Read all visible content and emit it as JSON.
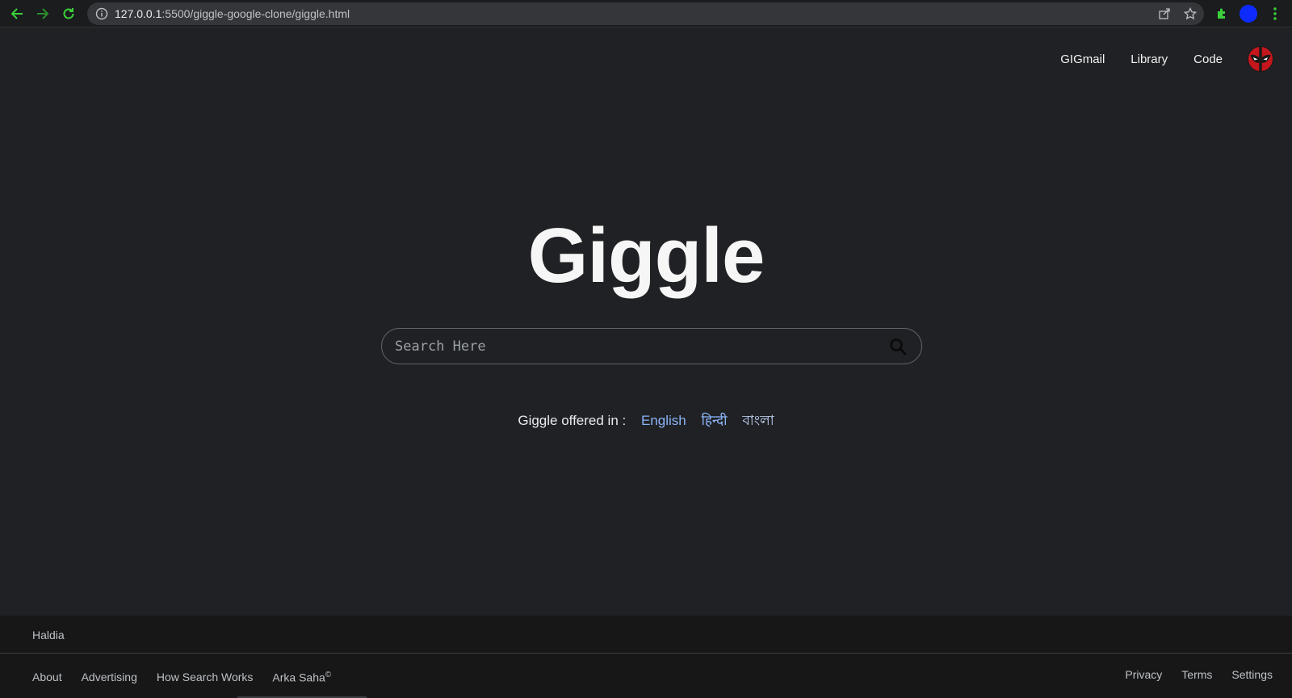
{
  "browser": {
    "url_host": "127.0.0.1",
    "url_rest": ":5500/giggle-google-clone/giggle.html",
    "icons": [
      "back-arrow-icon",
      "forward-arrow-icon",
      "reload-icon",
      "info-icon",
      "share-icon",
      "star-icon",
      "extensions-icon",
      "profile-icon",
      "menu-icon"
    ]
  },
  "topnav": {
    "gmail": "GIGmail",
    "library": "Library",
    "code": "Code",
    "avatar_icon": "deadpool-avatar-icon"
  },
  "logo": "Giggle",
  "search": {
    "placeholder": "Search Here",
    "icon": "search-icon"
  },
  "offered": {
    "label": "Giggle offered in :",
    "languages": [
      "English",
      "हिन्दी",
      "বাংলা"
    ]
  },
  "footer": {
    "location": "Haldia",
    "left_links": [
      "About",
      "Advertising",
      "How Search Works",
      "Arka Saha"
    ],
    "copyright_mark": "©",
    "right_links": [
      "Privacy",
      "Terms",
      "Settings"
    ]
  },
  "colors": {
    "page_bg": "#202124",
    "footer_bg": "#171717",
    "link_blue": "#8ab4f8",
    "chrome_accent_green": "#3bd13b",
    "profile_blue": "#0d2bff"
  }
}
